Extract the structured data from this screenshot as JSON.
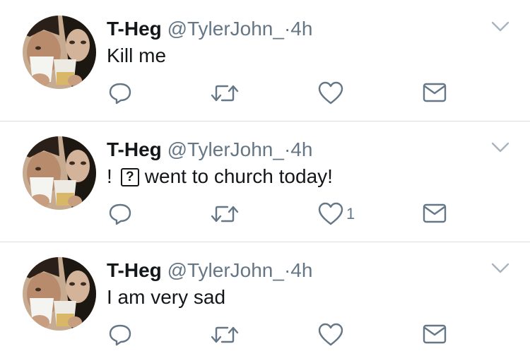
{
  "tweets": [
    {
      "name": "T-Heg",
      "handle": "@TylerJohn_",
      "dot": "·",
      "time": "4h",
      "text": "Kill me",
      "like_count": ""
    },
    {
      "name": "T-Heg",
      "handle": "@TylerJohn_",
      "dot": "·",
      "time": "4h",
      "text_prefix": "!",
      "unknown_glyph": "?",
      "text": "went to church today!",
      "like_count": "1"
    },
    {
      "name": "T-Heg",
      "handle": "@TylerJohn_",
      "dot": "·",
      "time": "4h",
      "text": "I am very sad",
      "like_count": ""
    }
  ],
  "icons": {
    "reply": "reply-icon",
    "retweet": "retweet-icon",
    "like": "heart-icon",
    "dm": "envelope-icon",
    "caret": "chevron-down-icon"
  },
  "colors": {
    "text": "#14171a",
    "secondary": "#657786",
    "divider": "#d9dde1"
  }
}
